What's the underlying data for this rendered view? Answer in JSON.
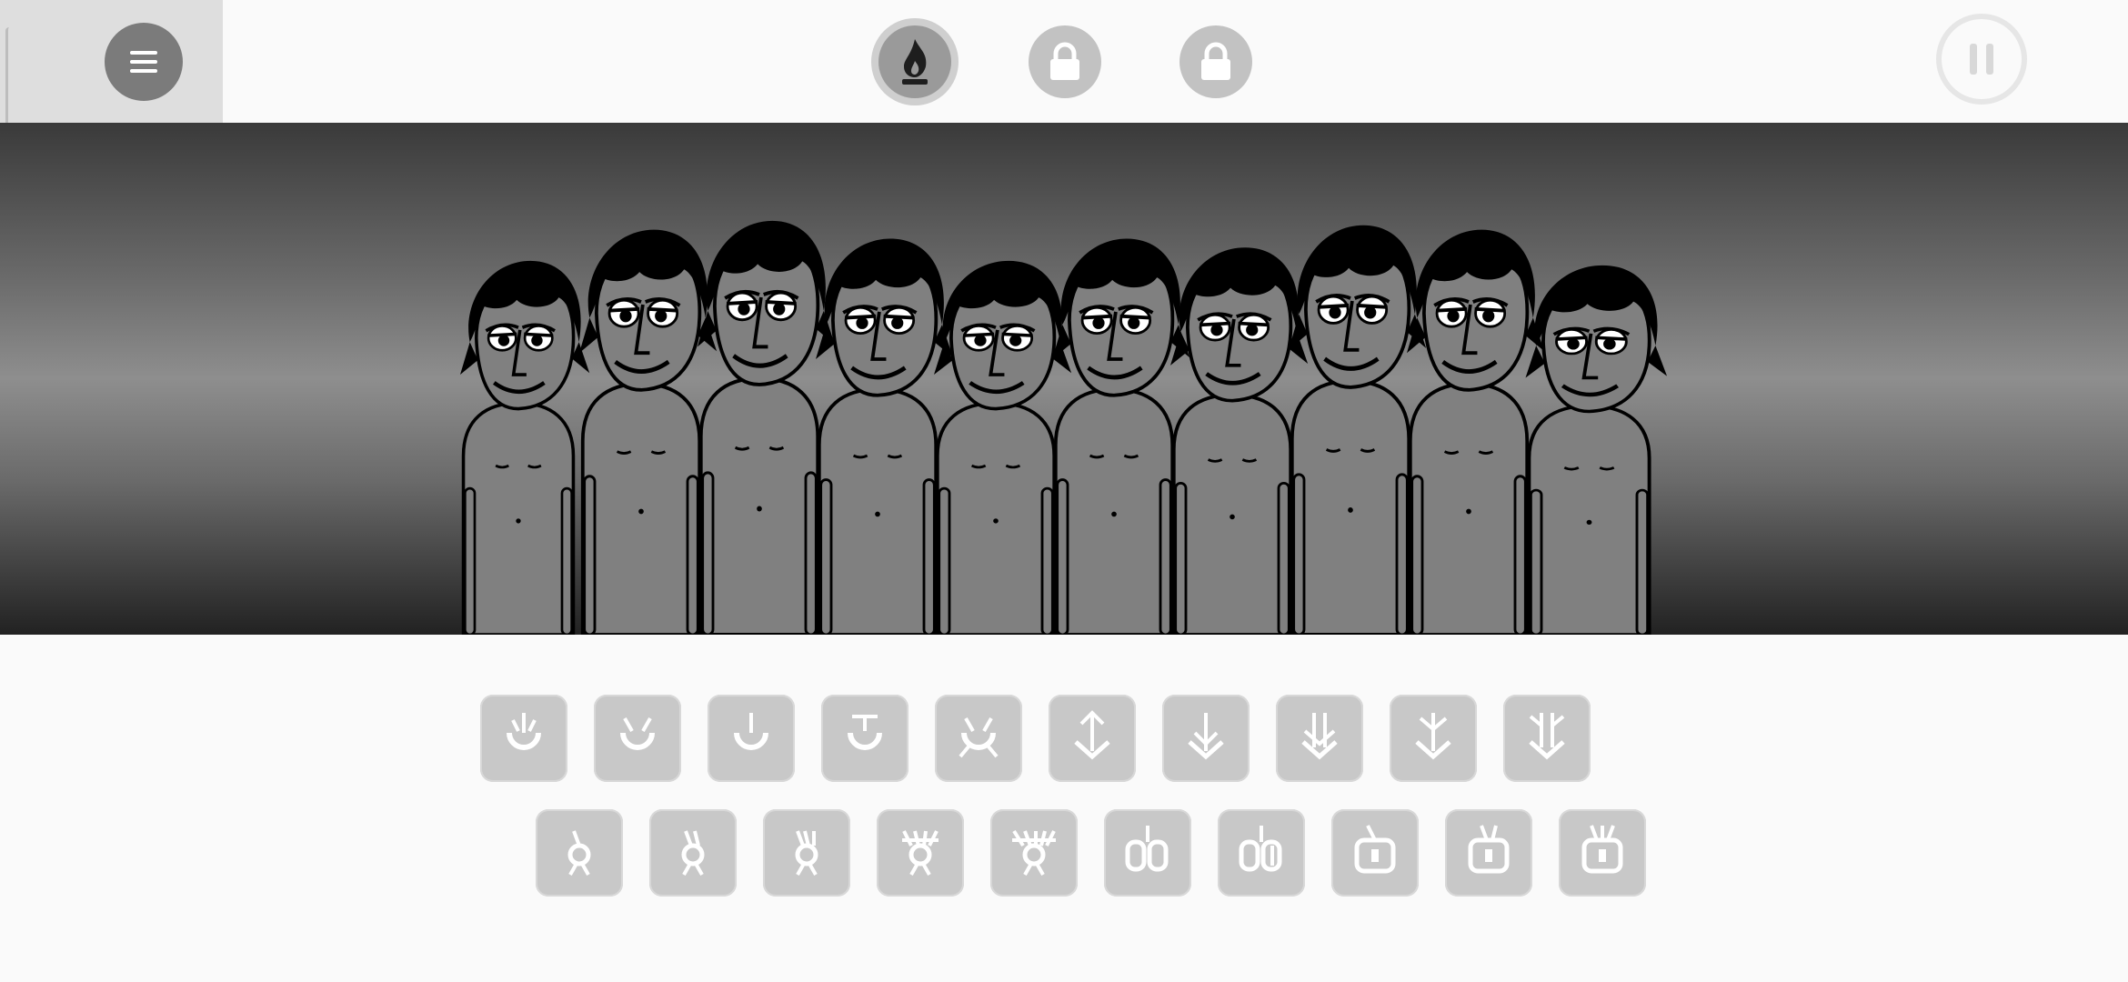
{
  "topbar": {
    "menu_icon": "menu-icon",
    "mode_icon": "flame-icon",
    "locked_icons": [
      "lock-icon",
      "lock-icon"
    ],
    "pause_icon": "pause-icon"
  },
  "stage": {
    "performer_count": 10,
    "background": "gray gradient"
  },
  "palette": {
    "row1": [
      "beat-1",
      "beat-2",
      "beat-3",
      "beat-4",
      "beat-5",
      "effect-1",
      "effect-2",
      "effect-3",
      "effect-4",
      "effect-5"
    ],
    "row2": [
      "melody-1",
      "melody-2",
      "melody-3",
      "melody-4",
      "melody-5",
      "voice-1",
      "voice-2",
      "voice-3",
      "voice-4",
      "voice-5"
    ]
  },
  "colors": {
    "background": "#fafafa",
    "menu_panel": "#dedede",
    "button_gray": "#c2c2c2",
    "skin_gray": "#808080",
    "outline": "#000000"
  }
}
